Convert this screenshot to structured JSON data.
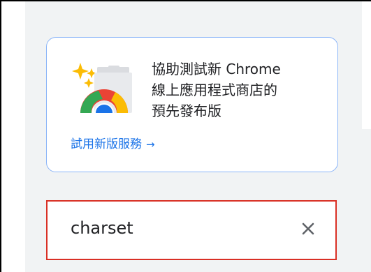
{
  "promo": {
    "text": "協助測試新 Chrome\n線上應用程式商店的\n預先發布版",
    "link_label": "試用新版服務",
    "link_arrow": "→",
    "icon": "chrome-web-store-sparkle-icon"
  },
  "search": {
    "value": "charset",
    "clear_icon": "close-icon"
  },
  "colors": {
    "accent_blue": "#1a73e8",
    "card_border": "#8ab4f8",
    "focus_red": "#d93025",
    "sidebar_bg": "#f1f3f4"
  }
}
